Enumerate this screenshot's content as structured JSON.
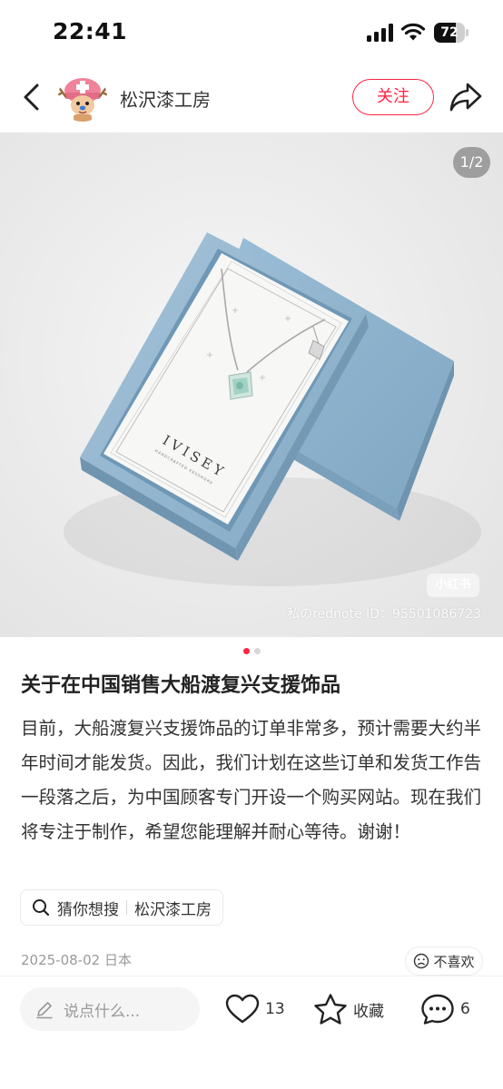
{
  "status_bar": {
    "time": "22:41",
    "battery_level": "72",
    "battery_fraction": 0.72,
    "icons": [
      "cellular-signal-icon",
      "wifi-icon",
      "battery-icon"
    ]
  },
  "header": {
    "author_name": "松沢漆工房",
    "follow_label": "关注",
    "icons": [
      "back-arrow-icon",
      "share-icon"
    ]
  },
  "carousel": {
    "page_indicator": "1/2",
    "current_page": 1,
    "total_pages": 2,
    "watermark_logo": "小红书",
    "watermark_text": "私のrednote ID：95501086723",
    "product_brand": "IVISEY",
    "product_subtitle": "HANDCRAFTED KESSHOKU"
  },
  "post": {
    "title": "关于在中国销售大船渡复兴支援饰品",
    "body": "目前，大船渡复兴支援饰品的订单非常多，预计需要大约半年时间才能发货。因此，我们计划在这些订单和发货工作告一段落之后，为中国顾客专门开设一个购买网站。现在我们将专注于制作，希望您能理解并耐心等待。谢谢！",
    "tag_prefix": "猜你想搜",
    "tag_value": "松沢漆工房",
    "date": "2025-08-02",
    "location": "日本",
    "dislike_label": "不喜欢"
  },
  "bottom_bar": {
    "comment_placeholder": "说点什么...",
    "likes": "13",
    "favorite_label": "收藏",
    "comments": "6"
  },
  "colors": {
    "accent": "#ff2442",
    "box_blue": "#8fb3cd",
    "text": "#222222",
    "muted": "#9a9a9a"
  }
}
